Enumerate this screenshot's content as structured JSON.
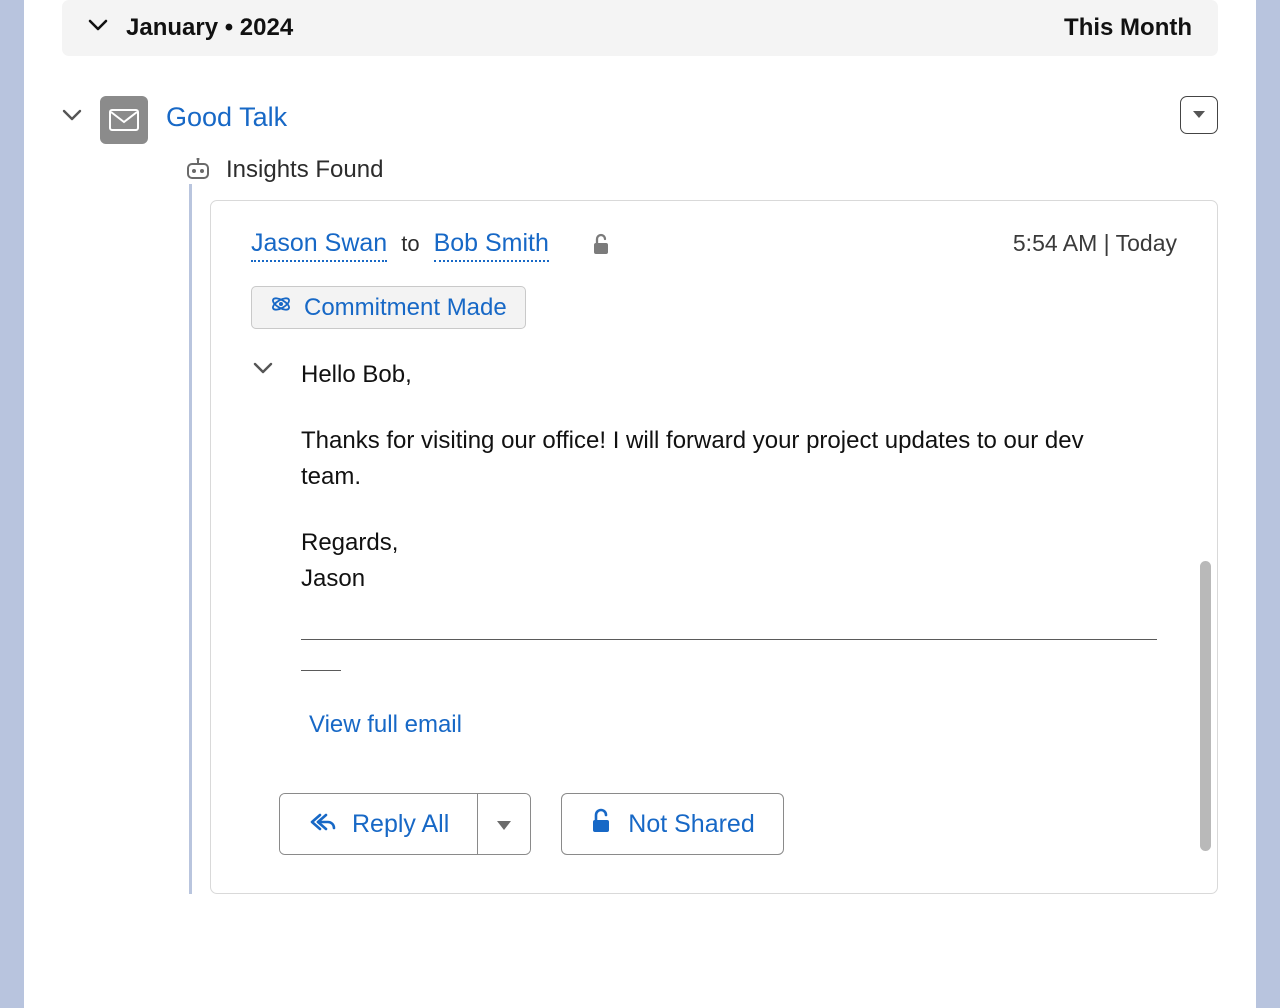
{
  "dateBanner": {
    "label": "January • 2024",
    "rightLabel": "This Month"
  },
  "conversation": {
    "title": "Good Talk",
    "insightsLabel": "Insights Found"
  },
  "email": {
    "from": "Jason Swan",
    "toLabel": "to",
    "to": "Bob Smith",
    "timestamp": "5:54 AM | Today",
    "badge": "Commitment Made",
    "body": {
      "greeting": "Hello Bob,",
      "para1": "Thanks for visiting our office! I will forward your project updates to our dev team.",
      "closing": "Regards,",
      "signature": "Jason"
    },
    "viewFull": "View full email",
    "replyAll": "Reply All",
    "notShared": "Not Shared"
  }
}
